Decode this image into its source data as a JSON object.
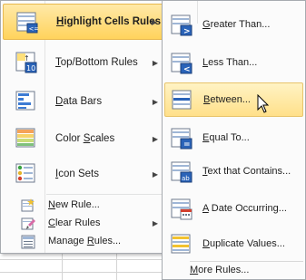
{
  "main_menu": {
    "items": [
      {
        "label_pre": "",
        "label_key": "H",
        "label_post": "ighlight Cells Rules",
        "icon": "highlight-cells-rules-icon"
      },
      {
        "label_pre": "",
        "label_key": "T",
        "label_post": "op/Bottom Rules",
        "icon": "top-bottom-rules-icon"
      },
      {
        "label_pre": "",
        "label_key": "D",
        "label_post": "ata Bars",
        "icon": "data-bars-icon"
      },
      {
        "label_pre": "Color ",
        "label_key": "S",
        "label_post": "cales",
        "icon": "color-scales-icon"
      },
      {
        "label_pre": "",
        "label_key": "I",
        "label_post": "con Sets",
        "icon": "icon-sets-icon"
      }
    ],
    "small_items": [
      {
        "label_pre": "",
        "label_key": "N",
        "label_post": "ew Rule...",
        "icon": "new-rule-icon"
      },
      {
        "label_pre": "",
        "label_key": "C",
        "label_post": "lear Rules",
        "icon": "clear-rules-icon"
      },
      {
        "label_pre": "Manage ",
        "label_key": "R",
        "label_post": "ules...",
        "icon": "manage-rules-icon"
      }
    ],
    "submenu_arrow": "▶"
  },
  "sub_menu": {
    "items": [
      {
        "label_pre": "",
        "label_key": "G",
        "label_post": "reater Than...",
        "icon": "greater-than-icon",
        "symbol": ">"
      },
      {
        "label_pre": "",
        "label_key": "L",
        "label_post": "ess Than...",
        "icon": "less-than-icon",
        "symbol": "<"
      },
      {
        "label_pre": "",
        "label_key": "B",
        "label_post": "etween...",
        "icon": "between-icon",
        "symbol": ""
      },
      {
        "label_pre": "",
        "label_key": "E",
        "label_post": "qual To...",
        "icon": "equal-to-icon",
        "symbol": "="
      },
      {
        "label_pre": "",
        "label_key": "T",
        "label_post": "ext that Contains...",
        "icon": "text-contains-icon",
        "symbol": "ab"
      },
      {
        "label_pre": "",
        "label_key": "A",
        "label_post": " Date Occurring...",
        "icon": "date-occurring-icon",
        "symbol": ""
      },
      {
        "label_pre": "",
        "label_key": "D",
        "label_post": "uplicate Values...",
        "icon": "duplicate-values-icon",
        "symbol": ""
      }
    ],
    "more_pre": "",
    "more_key": "M",
    "more_post": "ore Rules..."
  },
  "colors": {
    "active_highlight": "#ffd35c",
    "hover_highlight": "#ffe08a",
    "menu_border": "#a7abb0"
  }
}
